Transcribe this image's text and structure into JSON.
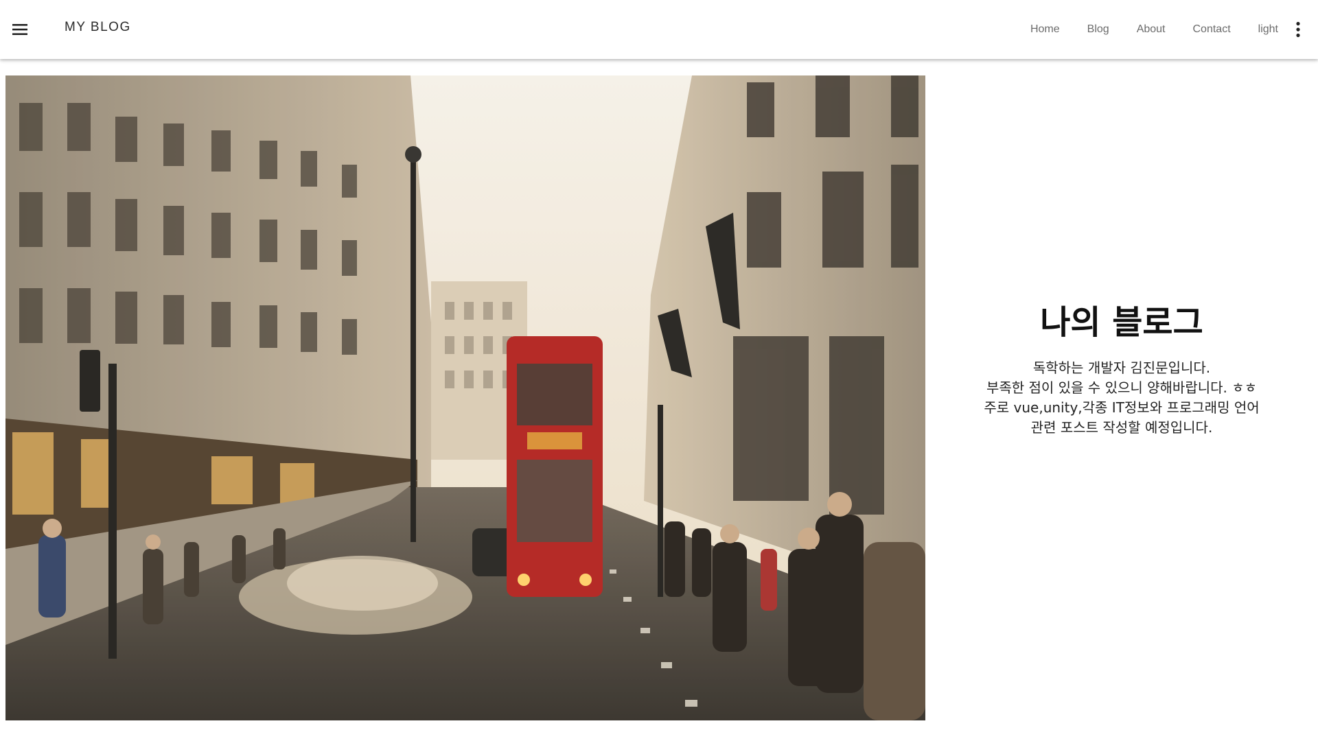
{
  "header": {
    "title": "MY BLOG",
    "menu_icon": "hamburger-menu-icon",
    "more_icon": "more-vertical-icon",
    "nav": [
      {
        "label": "Home"
      },
      {
        "label": "Blog"
      },
      {
        "label": "About"
      },
      {
        "label": "Contact"
      },
      {
        "label": "light"
      }
    ]
  },
  "hero": {
    "image_description": "London street with a red double-decker bus"
  },
  "intro": {
    "title": "나의 블로그",
    "lines": [
      "독학하는 개발자 김진문입니다.",
      "부족한 점이 있을 수 있으니 양해바랍니다. ㅎㅎ",
      "주로 vue,unity,각종 IT정보와 프로그래밍 언어",
      "관련 포스트 작성할 예정입니다."
    ]
  },
  "colors": {
    "app_bar": "#ffffff",
    "text_primary": "#111111",
    "nav_text": "#6b6b6b",
    "bus_red": "#b01d1d"
  }
}
